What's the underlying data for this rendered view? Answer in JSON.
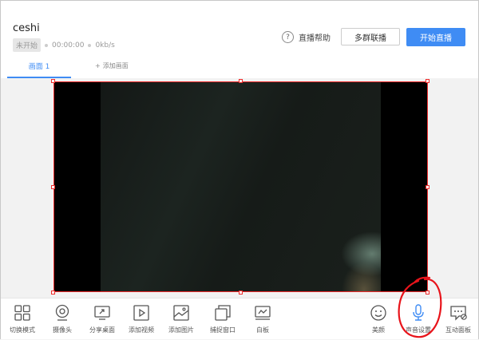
{
  "window": {
    "controls": [
      "⚙",
      "—",
      "☐",
      "✕"
    ]
  },
  "header": {
    "title": "ceshi",
    "status_badge": "未开始",
    "time": "00:00:00",
    "bitrate": "0kb/s",
    "help_label": "直播帮助",
    "help_icon": "?",
    "multi_button": "多群联播",
    "start_button": "开始直播"
  },
  "tabs": {
    "active": "画面 1",
    "add_label": "添加画面",
    "add_icon": "+"
  },
  "toolbar": {
    "items": [
      {
        "label": "切换模式",
        "icon": "grid-icon"
      },
      {
        "label": "摄像头",
        "icon": "camera-icon"
      },
      {
        "label": "分享桌面",
        "icon": "share-desktop-icon"
      },
      {
        "label": "添加视频",
        "icon": "video-play-icon"
      },
      {
        "label": "添加图片",
        "icon": "image-icon"
      },
      {
        "label": "捕捉窗口",
        "icon": "window-capture-icon"
      },
      {
        "label": "白板",
        "icon": "whiteboard-icon"
      },
      {
        "label": "美颜",
        "icon": "smile-icon"
      },
      {
        "label": "声音设置",
        "icon": "microphone-icon"
      },
      {
        "label": "互动面板",
        "icon": "chat-panel-icon"
      }
    ]
  },
  "colors": {
    "accent": "#3f8cf4",
    "selection": "#ee2b2b",
    "mic": "#3f8cf4"
  }
}
